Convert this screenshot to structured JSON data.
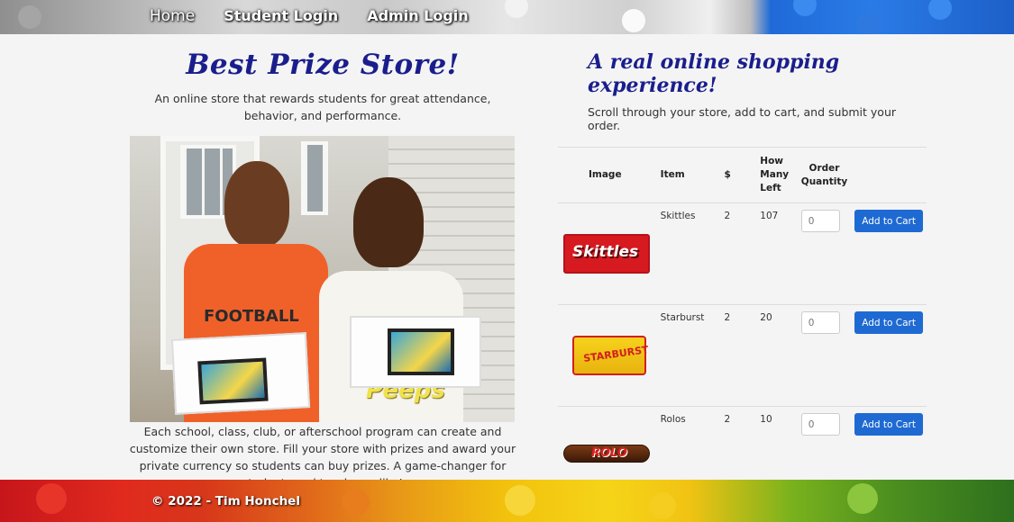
{
  "nav": {
    "home": "Home",
    "student_login": "Student Login",
    "admin_login": "Admin Login"
  },
  "left": {
    "title": "Best Prize Store!",
    "intro": "An online store that rewards students for great attendance, behavior, and performance.",
    "outro": "Each school, class, club, or afterschool program can create and customize their own store. Fill your store with prizes and award your private currency so students can buy prizes. A game-changer for students and teachers alike!",
    "photo_box_text": "Peeps",
    "photo_shirt_text": "FOOTBALL"
  },
  "right": {
    "title": "A real online shopping experience!",
    "subtitle": "Scroll through your store, add to cart, and submit your order."
  },
  "table": {
    "headers": {
      "image": "Image",
      "item": "Item",
      "price": "$",
      "left": "How Many Left",
      "qty": "Order Quantity"
    },
    "rows": [
      {
        "item": "Skittles",
        "price": "2",
        "left": "107",
        "qty_placeholder": "0",
        "button": "Add to Cart",
        "logo_text": "Skittles",
        "logo_color": "#d71920"
      },
      {
        "item": "Starburst",
        "price": "2",
        "left": "20",
        "qty_placeholder": "0",
        "button": "Add to Cart",
        "logo_text": "STARBURST",
        "logo_color": "#e8b30f"
      },
      {
        "item": "Rolos",
        "price": "2",
        "left": "10",
        "qty_placeholder": "0",
        "button": "Add to Cart",
        "logo_text": "ROLO",
        "logo_color": "#5a2a10"
      }
    ]
  },
  "footer": {
    "copyright": "© 2022 - Tim Honchel"
  },
  "colors": {
    "accent": "#1e6ad2",
    "title": "#1a1e8c"
  }
}
